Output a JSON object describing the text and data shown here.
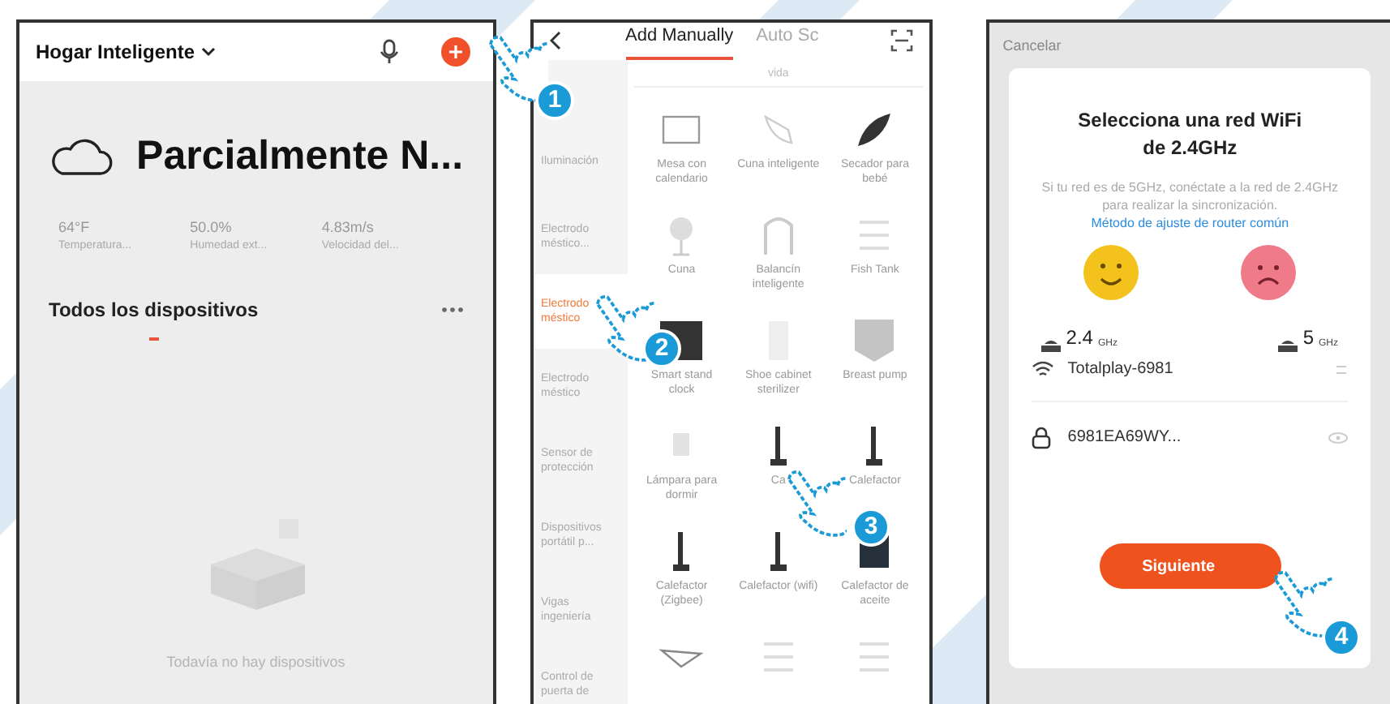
{
  "home": {
    "title": "Hogar Inteligente",
    "weather": {
      "condition": "Parcialmente N...",
      "stats": [
        {
          "value": "64°F",
          "label": "Temperatura..."
        },
        {
          "value": "50.0%",
          "label": "Humedad ext..."
        },
        {
          "value": "4.83m/s",
          "label": "Velocidad del..."
        }
      ]
    },
    "section": "Todos los dispositivos",
    "empty": "Todavía no hay dispositivos"
  },
  "add_device": {
    "tabs": [
      {
        "label": "Add Manually",
        "selected": true
      },
      {
        "label": "Auto Sc",
        "selected": false
      }
    ],
    "categories": [
      {
        "label": "Iluminación",
        "selected": false
      },
      {
        "label": "Electrodo méstico...",
        "selected": false
      },
      {
        "label": "Electrodo méstico",
        "selected": true
      },
      {
        "label": "Electrodo méstico",
        "selected": false
      },
      {
        "label": "Sensor de protección",
        "selected": false
      },
      {
        "label": "Dispositivos portátil p...",
        "selected": false
      },
      {
        "label": "Vigas ingeniería",
        "selected": false
      },
      {
        "label": "Control de puerta de",
        "selected": false
      }
    ],
    "group": "vida",
    "devices": [
      {
        "kind": "frame",
        "label": "Mesa con calendario"
      },
      {
        "kind": "chair",
        "label": "Cuna inteligente"
      },
      {
        "kind": "leaf",
        "label": "Secador para bebé"
      },
      {
        "kind": "fan",
        "label": "Cuna"
      },
      {
        "kind": "arch",
        "label": "Balancín inteligente"
      },
      {
        "kind": "rack",
        "label": "Fish Tank"
      },
      {
        "kind": "clock",
        "label": "Smart stand clock"
      },
      {
        "kind": "cabinet",
        "label": "Shoe cabinet sterilizer"
      },
      {
        "kind": "pump",
        "label": "Breast pump"
      },
      {
        "kind": "lamp",
        "label": "Lámpara para dormir"
      },
      {
        "kind": "heater",
        "label": "Ca"
      },
      {
        "kind": "heater",
        "label": "Calefactor"
      },
      {
        "kind": "heater",
        "label": "Calefactor (Zigbee)"
      },
      {
        "kind": "heater",
        "label": "Calefactor (wifi)"
      },
      {
        "kind": "panel",
        "label": "Calefactor de aceite"
      },
      {
        "kind": "plane"
      },
      {
        "kind": "rack"
      },
      {
        "kind": "rack"
      }
    ]
  },
  "wifi": {
    "cancel": "Cancelar",
    "title": "Selecciona una red WiFi de 2.4GHz",
    "note": "Si tu red es de 5GHz, conéctate a la red de 2.4GHz para realizar la sincronización.",
    "link": "Método de ajuste de router común",
    "bands": [
      {
        "value": "2.4",
        "unit": "GHz",
        "supported": true
      },
      {
        "value": "5",
        "unit": "GHz",
        "supported": false
      }
    ],
    "network": "Totalplay-6981",
    "password": "6981EA69WY...",
    "button": "Siguiente"
  },
  "steps": [
    {
      "number": "1"
    },
    {
      "number": "2"
    },
    {
      "number": "3"
    },
    {
      "number": "4"
    }
  ]
}
